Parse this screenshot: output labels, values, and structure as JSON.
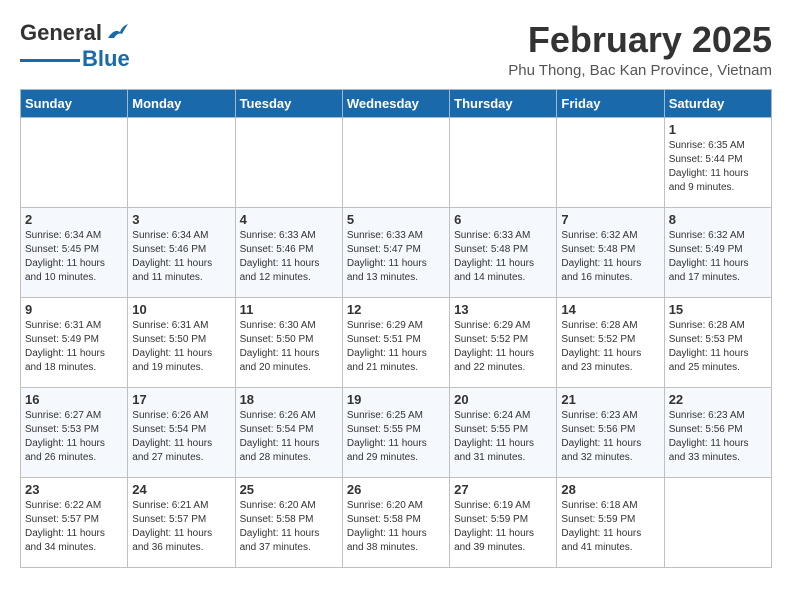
{
  "header": {
    "logo_general": "General",
    "logo_blue": "Blue",
    "month_title": "February 2025",
    "location": "Phu Thong, Bac Kan Province, Vietnam"
  },
  "weekdays": [
    "Sunday",
    "Monday",
    "Tuesday",
    "Wednesday",
    "Thursday",
    "Friday",
    "Saturday"
  ],
  "weeks": [
    [
      {
        "day": "",
        "info": ""
      },
      {
        "day": "",
        "info": ""
      },
      {
        "day": "",
        "info": ""
      },
      {
        "day": "",
        "info": ""
      },
      {
        "day": "",
        "info": ""
      },
      {
        "day": "",
        "info": ""
      },
      {
        "day": "1",
        "info": "Sunrise: 6:35 AM\nSunset: 5:44 PM\nDaylight: 11 hours\nand 9 minutes."
      }
    ],
    [
      {
        "day": "2",
        "info": "Sunrise: 6:34 AM\nSunset: 5:45 PM\nDaylight: 11 hours\nand 10 minutes."
      },
      {
        "day": "3",
        "info": "Sunrise: 6:34 AM\nSunset: 5:46 PM\nDaylight: 11 hours\nand 11 minutes."
      },
      {
        "day": "4",
        "info": "Sunrise: 6:33 AM\nSunset: 5:46 PM\nDaylight: 11 hours\nand 12 minutes."
      },
      {
        "day": "5",
        "info": "Sunrise: 6:33 AM\nSunset: 5:47 PM\nDaylight: 11 hours\nand 13 minutes."
      },
      {
        "day": "6",
        "info": "Sunrise: 6:33 AM\nSunset: 5:48 PM\nDaylight: 11 hours\nand 14 minutes."
      },
      {
        "day": "7",
        "info": "Sunrise: 6:32 AM\nSunset: 5:48 PM\nDaylight: 11 hours\nand 16 minutes."
      },
      {
        "day": "8",
        "info": "Sunrise: 6:32 AM\nSunset: 5:49 PM\nDaylight: 11 hours\nand 17 minutes."
      }
    ],
    [
      {
        "day": "9",
        "info": "Sunrise: 6:31 AM\nSunset: 5:49 PM\nDaylight: 11 hours\nand 18 minutes."
      },
      {
        "day": "10",
        "info": "Sunrise: 6:31 AM\nSunset: 5:50 PM\nDaylight: 11 hours\nand 19 minutes."
      },
      {
        "day": "11",
        "info": "Sunrise: 6:30 AM\nSunset: 5:50 PM\nDaylight: 11 hours\nand 20 minutes."
      },
      {
        "day": "12",
        "info": "Sunrise: 6:29 AM\nSunset: 5:51 PM\nDaylight: 11 hours\nand 21 minutes."
      },
      {
        "day": "13",
        "info": "Sunrise: 6:29 AM\nSunset: 5:52 PM\nDaylight: 11 hours\nand 22 minutes."
      },
      {
        "day": "14",
        "info": "Sunrise: 6:28 AM\nSunset: 5:52 PM\nDaylight: 11 hours\nand 23 minutes."
      },
      {
        "day": "15",
        "info": "Sunrise: 6:28 AM\nSunset: 5:53 PM\nDaylight: 11 hours\nand 25 minutes."
      }
    ],
    [
      {
        "day": "16",
        "info": "Sunrise: 6:27 AM\nSunset: 5:53 PM\nDaylight: 11 hours\nand 26 minutes."
      },
      {
        "day": "17",
        "info": "Sunrise: 6:26 AM\nSunset: 5:54 PM\nDaylight: 11 hours\nand 27 minutes."
      },
      {
        "day": "18",
        "info": "Sunrise: 6:26 AM\nSunset: 5:54 PM\nDaylight: 11 hours\nand 28 minutes."
      },
      {
        "day": "19",
        "info": "Sunrise: 6:25 AM\nSunset: 5:55 PM\nDaylight: 11 hours\nand 29 minutes."
      },
      {
        "day": "20",
        "info": "Sunrise: 6:24 AM\nSunset: 5:55 PM\nDaylight: 11 hours\nand 31 minutes."
      },
      {
        "day": "21",
        "info": "Sunrise: 6:23 AM\nSunset: 5:56 PM\nDaylight: 11 hours\nand 32 minutes."
      },
      {
        "day": "22",
        "info": "Sunrise: 6:23 AM\nSunset: 5:56 PM\nDaylight: 11 hours\nand 33 minutes."
      }
    ],
    [
      {
        "day": "23",
        "info": "Sunrise: 6:22 AM\nSunset: 5:57 PM\nDaylight: 11 hours\nand 34 minutes."
      },
      {
        "day": "24",
        "info": "Sunrise: 6:21 AM\nSunset: 5:57 PM\nDaylight: 11 hours\nand 36 minutes."
      },
      {
        "day": "25",
        "info": "Sunrise: 6:20 AM\nSunset: 5:58 PM\nDaylight: 11 hours\nand 37 minutes."
      },
      {
        "day": "26",
        "info": "Sunrise: 6:20 AM\nSunset: 5:58 PM\nDaylight: 11 hours\nand 38 minutes."
      },
      {
        "day": "27",
        "info": "Sunrise: 6:19 AM\nSunset: 5:59 PM\nDaylight: 11 hours\nand 39 minutes."
      },
      {
        "day": "28",
        "info": "Sunrise: 6:18 AM\nSunset: 5:59 PM\nDaylight: 11 hours\nand 41 minutes."
      },
      {
        "day": "",
        "info": ""
      }
    ]
  ]
}
